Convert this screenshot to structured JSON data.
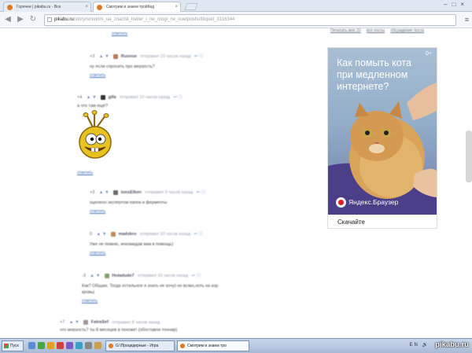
{
  "browser": {
    "tabs": [
      {
        "label": "Горячее | pikabu.ru - Все"
      },
      {
        "label": "Смотрим и знаем тройбед"
      }
    ],
    "url_host": "pikabu.ru",
    "url_path": "/story/smotrim_ua_znachit_treiler_i_ne_mogi_ne_ouetposhuttilquet_3116344"
  },
  "page": {
    "top_links": [
      "Печатать мне 20",
      "все посты",
      "обсуждение поста"
    ],
    "comments": [
      {
        "reply": "ответить"
      },
      {
        "score": "+3",
        "user": "Ruonse",
        "meta": "отправил 10 часов назад",
        "text": "ну если спросить про мерзость?",
        "reply": "ответить"
      },
      {
        "score": "+4",
        "user": "gifa",
        "meta": "отправил 10 часов назад",
        "text": "а что там ещё?",
        "reply": "ответить"
      },
      {
        "score": "+3",
        "user": "lonsElken",
        "meta": "отправил 9 часов назад",
        "text": "оценено экспертом папок и ферменты",
        "reply": "ответить"
      },
      {
        "score": "0",
        "user": "madskro",
        "meta": "отправил 10 часов назад",
        "text": "Уже не помню, инкомидав вам в помощь)",
        "reply": "ответить"
      },
      {
        "score": "-3",
        "user": "Holadude7",
        "meta": "отправил 10 часов назад",
        "text": "Как? Общаю. Тогда остальное я знать не хочу) но всяко,хоть на кор",
        "text2": "кровь)",
        "reply": "ответить"
      },
      {
        "score": "+7",
        "user": "FatraSef",
        "meta": "отправил 8 часов назад",
        "text": "что мерзость? ты 8 месяцев в похоже! (обоставли тоннир)"
      }
    ],
    "ad": {
      "title": "Как помыть кота при медленном интернете?",
      "age": "0+",
      "brand": "Яндекс.Браузер",
      "cta": "Скачайте"
    }
  },
  "taskbar": {
    "start": "Пуск",
    "buttons": [
      {
        "label": "G:\\Процедерные - Игра"
      },
      {
        "label": "Смотрим и знаем тро"
      }
    ],
    "tray": "EN 🔊"
  },
  "watermark": "pikabu.ru"
}
